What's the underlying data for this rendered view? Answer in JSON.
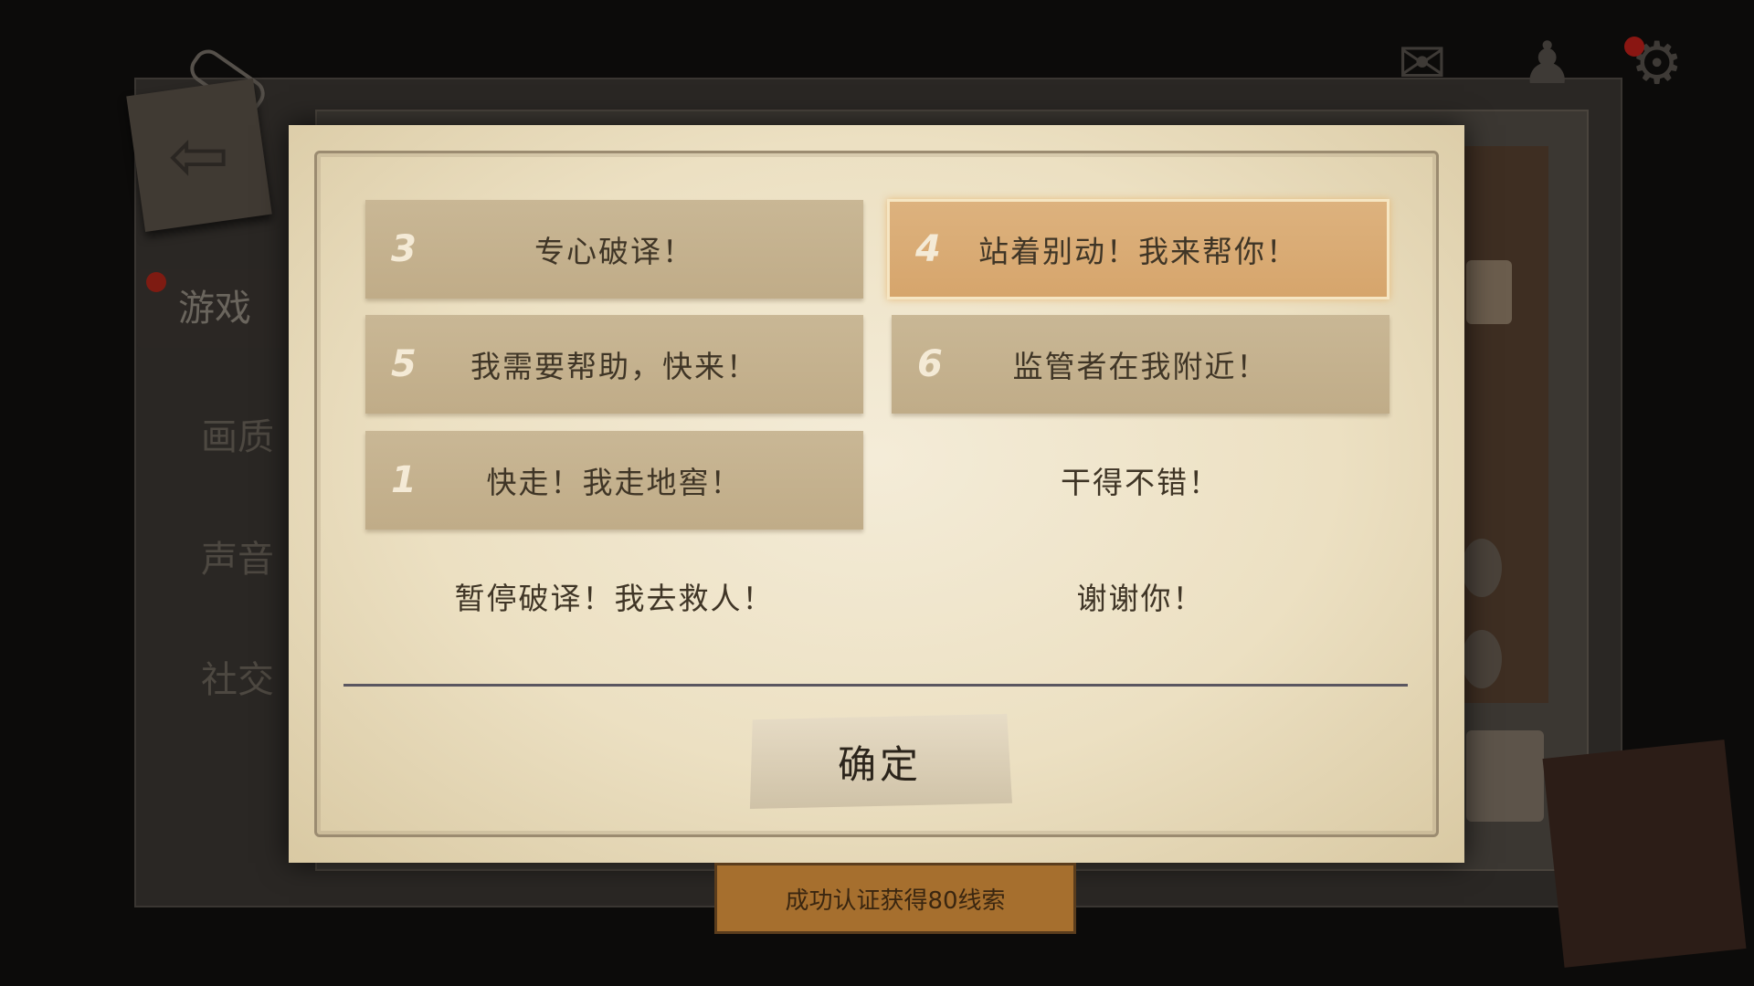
{
  "sidebar": {
    "tabs": [
      {
        "label": "游戏",
        "active": true
      },
      {
        "label": "画质",
        "active": false
      },
      {
        "label": "声音",
        "active": false
      },
      {
        "label": "社交",
        "active": false
      }
    ]
  },
  "dialog": {
    "options": [
      {
        "number": "3",
        "label": "专心破译！",
        "style": "filled"
      },
      {
        "number": "4",
        "label": "站着别动！我来帮你！",
        "style": "selected"
      },
      {
        "number": "5",
        "label": "我需要帮助，快来！",
        "style": "filled"
      },
      {
        "number": "6",
        "label": "监管者在我附近！",
        "style": "filled"
      },
      {
        "number": "1",
        "label": "快走！我走地窖！",
        "style": "filled"
      },
      {
        "number": "",
        "label": "干得不错！",
        "style": "plain"
      },
      {
        "number": "",
        "label": "暂停破译！我去救人！",
        "style": "plain"
      },
      {
        "number": "",
        "label": "谢谢你！",
        "style": "plain"
      }
    ],
    "confirm_label": "确定"
  },
  "banner": {
    "text": "成功认证获得80线索"
  },
  "icons": {
    "exit": "exit-door-icon",
    "settings": "gear-icon"
  },
  "colors": {
    "selected_option": "#d6a56c",
    "filled_option": "#c4b08d",
    "notification_dot": "#8a1612"
  }
}
